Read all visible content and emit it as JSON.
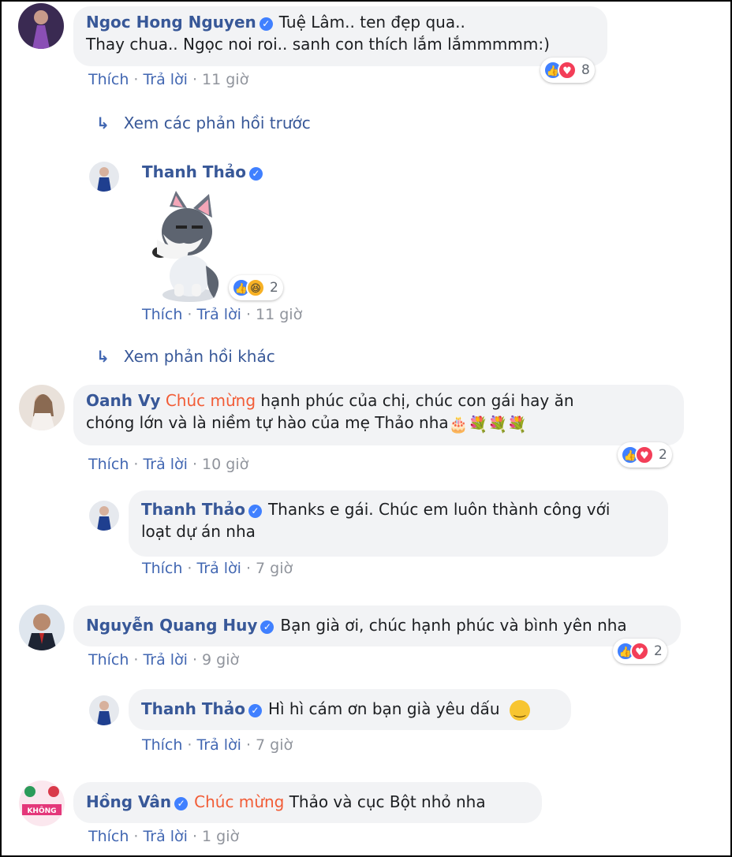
{
  "comments": [
    {
      "author": "Ngoc Hong Nguyen",
      "text": "Tuệ Lâm.. ten đẹp qua..",
      "text2": "Thay chua.. Ngọc noi roi.. sanh con thích lắm lắmmmmm:)",
      "like": "Thích",
      "reply": "Trả lời",
      "time": "11 giờ",
      "reactions": "8"
    },
    {
      "more": "Xem các phản hồi trước"
    },
    {
      "author": "Thanh Thảo",
      "sticker": "husky-dog-sticker",
      "like": "Thích",
      "reply": "Trả lời",
      "time": "11 giờ",
      "reactions": "2"
    },
    {
      "more": "Xem phản hồi khác"
    },
    {
      "author": "Oanh Vy",
      "highlight": "Chúc mừng",
      "text": "hạnh phúc của chị, chúc con gái hay ăn",
      "text2": "chóng lớn và là niềm tự hào của mẹ Thảo nha",
      "like": "Thích",
      "reply": "Trả lời",
      "time": "10 giờ",
      "reactions": "2"
    },
    {
      "author": "Thanh Thảo",
      "text": "Thanks e gái. Chúc em luôn thành công với",
      "text2": "loạt dự án nha",
      "like": "Thích",
      "reply": "Trả lời",
      "time": "7 giờ"
    },
    {
      "author": "Nguyễn Quang Huy",
      "text": "Bạn già ơi, chúc hạnh phúc và bình yên nha",
      "like": "Thích",
      "reply": "Trả lời",
      "time": "9 giờ",
      "reactions": "2"
    },
    {
      "author": "Thanh Thảo",
      "text": "Hì hì cám ơn bạn già yêu dấu",
      "like": "Thích",
      "reply": "Trả lời",
      "time": "7 giờ"
    },
    {
      "author": "Hồng Vân",
      "highlight": "Chúc mừng",
      "text": "Thảo và cục Bột nhỏ nha",
      "like": "Thích",
      "reply": "Trả lời",
      "time": "1 giờ"
    }
  ],
  "avatar_texts": {
    "hong_van": "KHÔNG"
  },
  "colors": {
    "name": "#385898",
    "link": "#4267b2",
    "highlight": "#f25c36",
    "bubble": "#f2f3f5",
    "like": "#4080ff",
    "love": "#f33e58"
  }
}
